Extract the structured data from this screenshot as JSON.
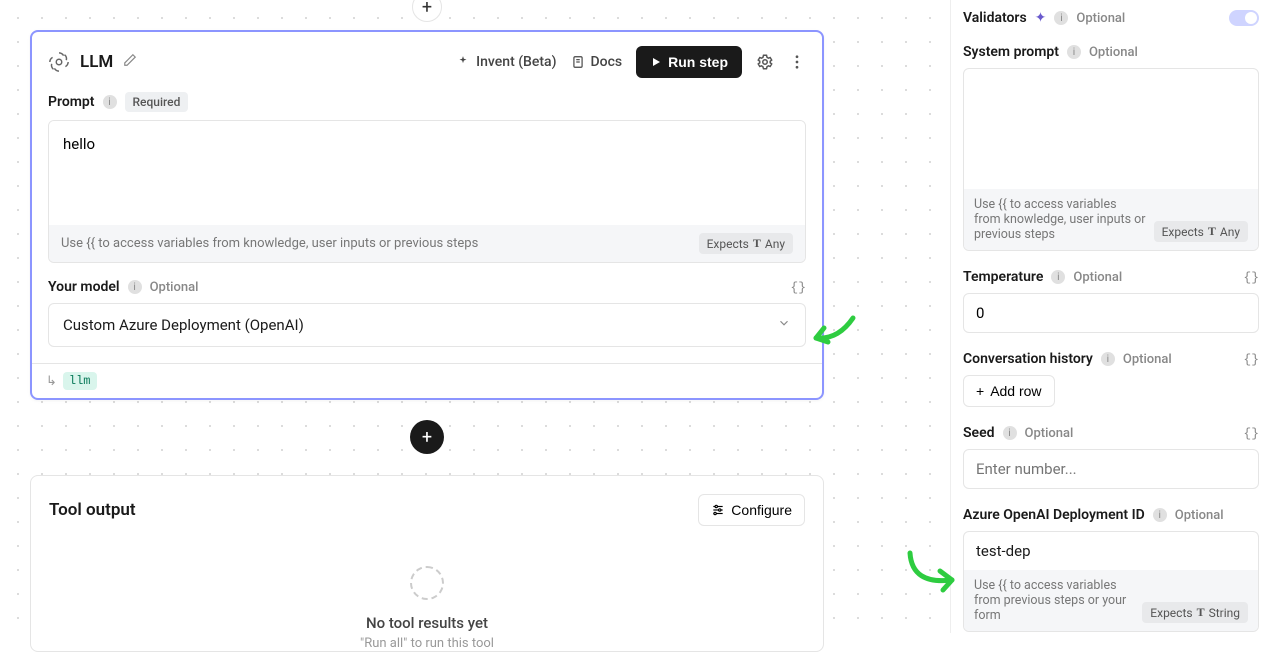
{
  "canvas": {
    "add_top": "+",
    "add_mid": "+"
  },
  "llm": {
    "title": "LLM",
    "invent_label": "Invent (Beta)",
    "docs_label": "Docs",
    "run_label": "Run step",
    "prompt_label": "Prompt",
    "required_badge": "Required",
    "prompt_value": "hello",
    "prompt_hint": "Use {{ to access variables from knowledge, user inputs or previous steps",
    "prompt_expects": "Expects",
    "prompt_expects_type": "Any",
    "model_label": "Your model",
    "optional_label": "Optional",
    "model_value": "Custom Azure Deployment (OpenAI)",
    "return_var": "llm"
  },
  "output": {
    "title": "Tool output",
    "configure_label": "Configure",
    "empty_title": "No tool results yet",
    "empty_sub": "\"Run all\" to run this tool"
  },
  "panel": {
    "validators_label": "Validators",
    "optional": "Optional",
    "sysprompt_label": "System prompt",
    "sysprompt_hint": "Use {{ to access variables from knowledge, user inputs or previous steps",
    "sysprompt_expects": "Expects",
    "sysprompt_expects_type": "Any",
    "temp_label": "Temperature",
    "temp_value": "0",
    "history_label": "Conversation history",
    "add_row_label": "Add row",
    "seed_label": "Seed",
    "seed_placeholder": "Enter number...",
    "azure_label": "Azure OpenAI Deployment ID",
    "azure_value": "test-dep",
    "azure_hint": "Use {{ to access variables from previous steps or your form",
    "azure_expects": "Expects",
    "azure_expects_type": "String"
  }
}
